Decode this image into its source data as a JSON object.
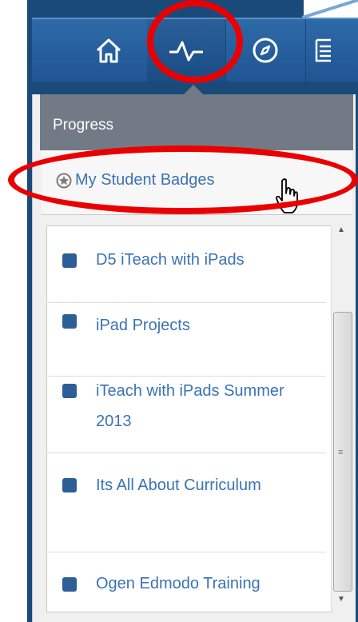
{
  "nav": {
    "items": [
      {
        "name": "home",
        "icon": "home-icon"
      },
      {
        "name": "progress",
        "icon": "pulse-icon",
        "active": true
      },
      {
        "name": "discover",
        "icon": "compass-icon"
      },
      {
        "name": "library",
        "icon": "book-icon"
      }
    ]
  },
  "dropdown": {
    "title": "Progress",
    "badges_link": "My Student Badges"
  },
  "groups": [
    {
      "label": "D5 iTeach with iPads"
    },
    {
      "label": "iPad Projects"
    },
    {
      "label": "iTeach with iPads Summer 2013"
    },
    {
      "label": "Its All About Curriculum"
    },
    {
      "label": "Ogen Edmodo Training"
    }
  ],
  "colors": {
    "accent": "#3a73b4",
    "nav_bar": "#1f5592",
    "annotation": "#ea0000"
  }
}
